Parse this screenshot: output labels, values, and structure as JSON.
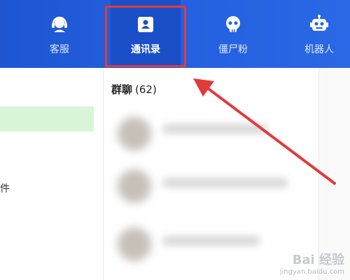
{
  "nav": {
    "items": [
      {
        "label": "客服",
        "icon": "headset-icon"
      },
      {
        "label": "通讯录",
        "icon": "contact-book-icon",
        "active": true
      },
      {
        "label": "僵尸粉",
        "icon": "skull-icon"
      },
      {
        "label": "机器人",
        "icon": "robot-icon"
      }
    ]
  },
  "left": {
    "partial_text": "件"
  },
  "contacts": {
    "group_title": "群聊",
    "group_count": "(62)"
  },
  "watermark": {
    "brand": "Bai 经验",
    "url": "jingyan.baidu.com"
  },
  "colors": {
    "topbar": "#2461e0",
    "highlight": "#e23b3b",
    "green_row": "#d8f5d8"
  }
}
